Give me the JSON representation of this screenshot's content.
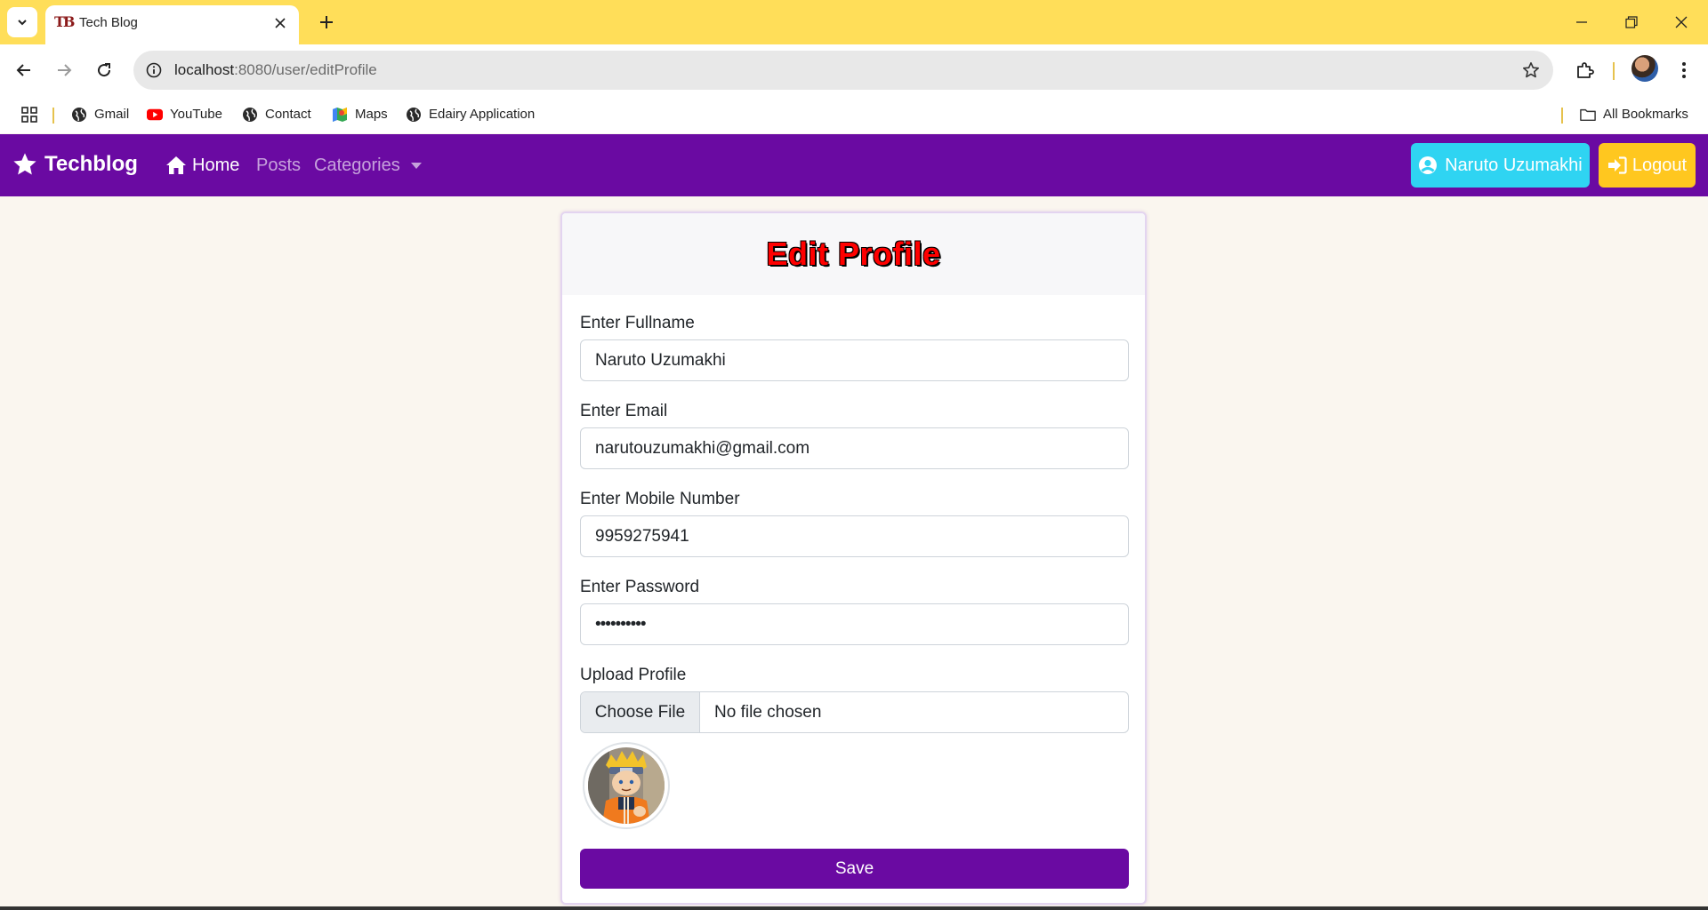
{
  "browser": {
    "tab_title": "Tech Blog",
    "tab_favicon_text": "TB",
    "url_host": "localhost",
    "url_rest": ":8080/user/editProfile",
    "bookmarks": [
      "Gmail",
      "YouTube",
      "Contact",
      "Maps",
      "Edairy Application"
    ],
    "all_bookmarks": "All Bookmarks"
  },
  "navbar": {
    "brand": "Techblog",
    "links": {
      "home": "Home",
      "posts": "Posts",
      "categories": "Categories"
    },
    "user_button": "Naruto Uzumakhi",
    "logout_button": "Logout",
    "colors": {
      "navbar": "#6a0aa2",
      "user_button": "#2fd4f2",
      "logout_button": "#ffc71f"
    }
  },
  "form": {
    "title": "Edit Profile",
    "fullname_label": "Enter Fullname",
    "fullname_value": "Naruto Uzumakhi",
    "email_label": "Enter Email",
    "email_value": "narutouzumakhi@gmail.com",
    "mobile_label": "Enter Mobile Number",
    "mobile_value": "9959275941",
    "password_label": "Enter Password",
    "password_value": "••••••••••",
    "upload_label": "Upload Profile",
    "choose_file": "Choose File",
    "no_file": "No file chosen",
    "save": "Save"
  }
}
